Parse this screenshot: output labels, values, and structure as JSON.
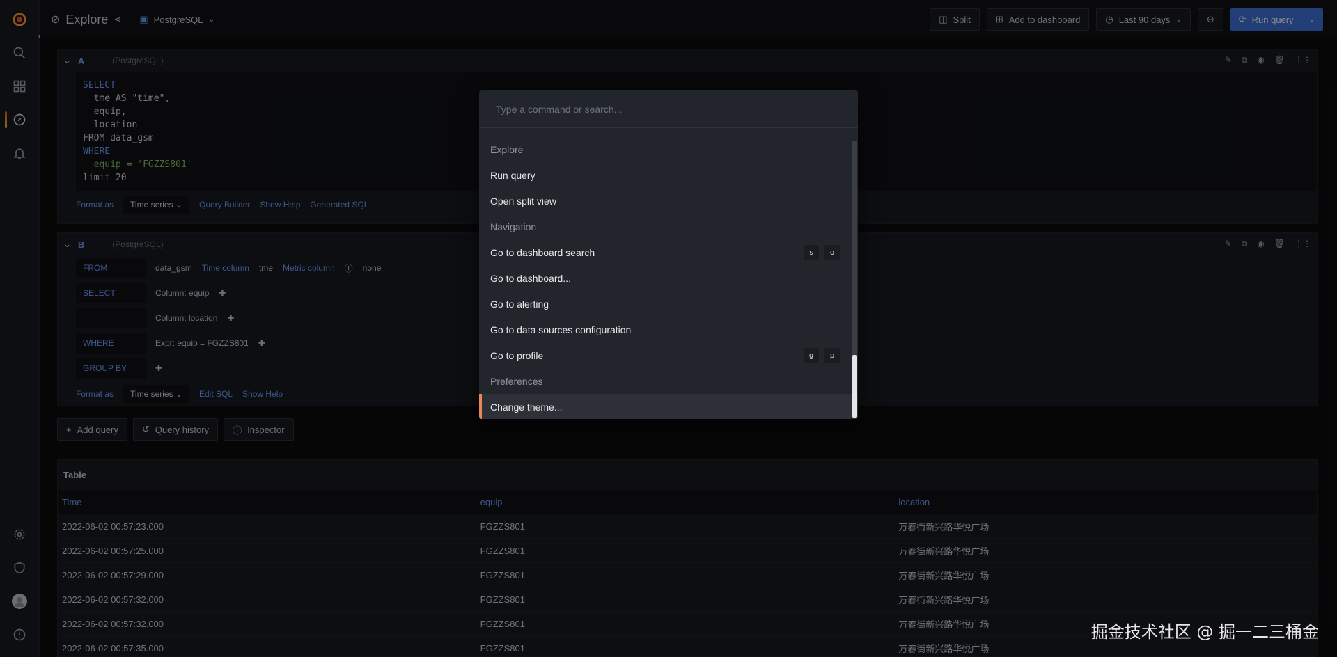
{
  "topbar": {
    "title": "Explore",
    "datasource": "PostgreSQL",
    "split": "Split",
    "add_to_dashboard": "Add to dashboard",
    "time_range": "Last 90 days",
    "run_query": "Run query"
  },
  "query_a": {
    "letter": "A",
    "datasource": "(PostgreSQL)",
    "sql_lines": [
      "SELECT",
      "  tme AS \"time\",",
      "  equip,",
      "  location",
      "FROM data_gsm",
      "WHERE",
      "  equip = 'FGZZS801'",
      "limit 20"
    ],
    "format_as_label": "Format as",
    "format_as_value": "Time series",
    "query_builder": "Query Builder",
    "show_help": "Show Help",
    "generated_sql": "Generated SQL"
  },
  "query_b": {
    "letter": "B",
    "datasource": "(PostgreSQL)",
    "from_label": "FROM",
    "from_value": "data_gsm",
    "time_column_label": "Time column",
    "time_column_value": "tme",
    "metric_column_label": "Metric column",
    "metric_column_value": "none",
    "select_label": "SELECT",
    "select_col1": "Column: equip",
    "select_col2": "Column: location",
    "where_label": "WHERE",
    "where_expr": "Expr: equip = FGZZS801",
    "group_by_label": "GROUP BY",
    "format_as_label": "Format as",
    "format_as_value": "Time series",
    "edit_sql": "Edit SQL",
    "show_help": "Show Help"
  },
  "actions": {
    "add_query": "Add query",
    "query_history": "Query history",
    "inspector": "Inspector"
  },
  "table": {
    "title": "Table",
    "columns": [
      "Time",
      "equip",
      "location"
    ],
    "rows": [
      [
        "2022-06-02 00:57:23.000",
        "FGZZS801",
        "万春街新兴路华悦广场"
      ],
      [
        "2022-06-02 00:57:25.000",
        "FGZZS801",
        "万春街新兴路华悦广场"
      ],
      [
        "2022-06-02 00:57:29.000",
        "FGZZS801",
        "万春街新兴路华悦广场"
      ],
      [
        "2022-06-02 00:57:32.000",
        "FGZZS801",
        "万春街新兴路华悦广场"
      ],
      [
        "2022-06-02 00:57:32.000",
        "FGZZS801",
        "万春街新兴路华悦广场"
      ],
      [
        "2022-06-02 00:57:35.000",
        "FGZZS801",
        "万春街新兴路华悦广场"
      ]
    ]
  },
  "palette": {
    "placeholder": "Type a command or search...",
    "items": [
      {
        "label": "Explore",
        "section": true
      },
      {
        "label": "Run query"
      },
      {
        "label": "Open split view"
      },
      {
        "label": "Navigation",
        "section": true
      },
      {
        "label": "Go to dashboard search",
        "keys": [
          "s",
          "o"
        ]
      },
      {
        "label": "Go to dashboard..."
      },
      {
        "label": "Go to alerting"
      },
      {
        "label": "Go to data sources configuration"
      },
      {
        "label": "Go to profile",
        "keys": [
          "g",
          "p"
        ]
      },
      {
        "label": "Preferences",
        "section": true
      },
      {
        "label": "Change theme...",
        "active": true
      }
    ]
  },
  "watermark": "掘金技术社区 @ 掘一二三桶金"
}
